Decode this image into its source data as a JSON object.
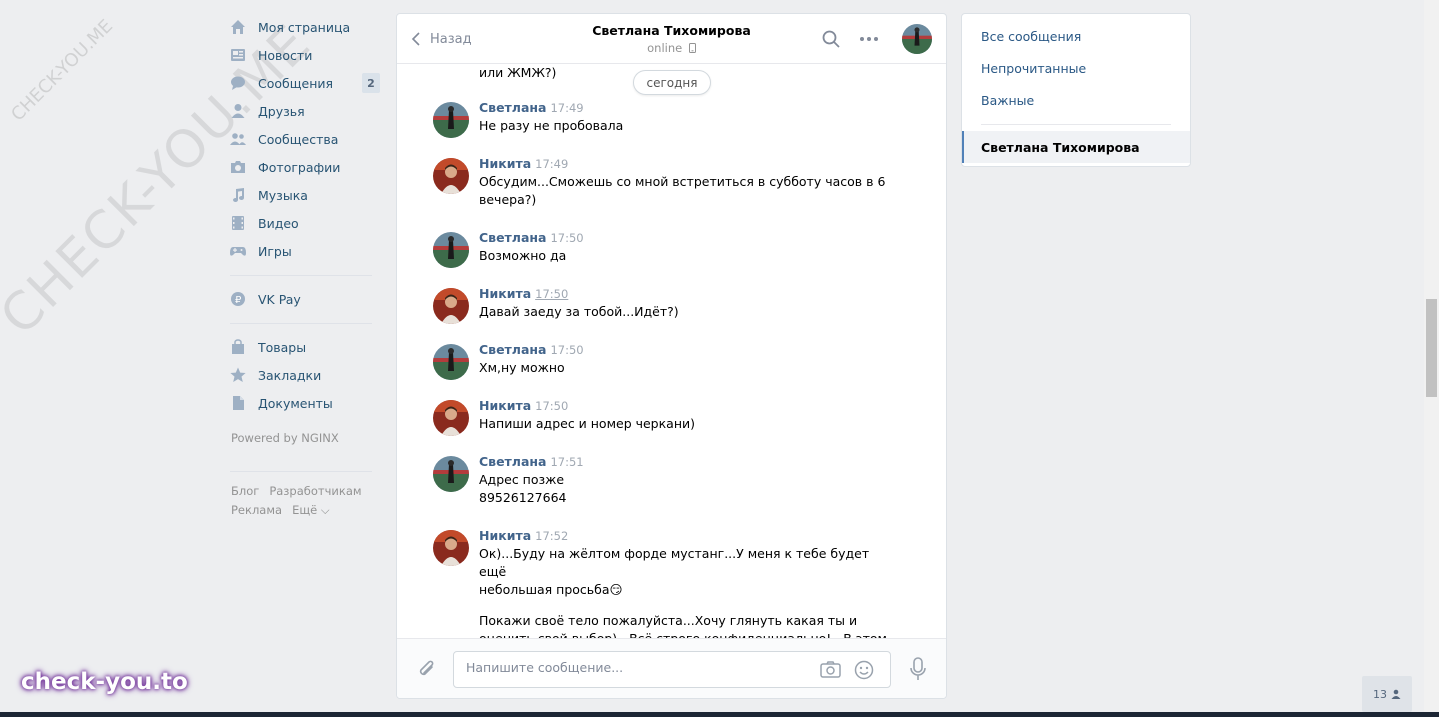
{
  "watermarks": {
    "diagonal_big": "CHECK-YOU.ME",
    "diagonal_small": "CHECK-YOU.ME",
    "brand": "check-you.to"
  },
  "leftnav": {
    "items": [
      {
        "label": "Моя страница",
        "icon": "home-icon"
      },
      {
        "label": "Новости",
        "icon": "news-icon"
      },
      {
        "label": "Сообщения",
        "icon": "messages-icon",
        "badge": "2"
      },
      {
        "label": "Друзья",
        "icon": "friends-icon"
      },
      {
        "label": "Сообщества",
        "icon": "communities-icon"
      },
      {
        "label": "Фотографии",
        "icon": "camera-icon"
      },
      {
        "label": "Музыка",
        "icon": "music-icon"
      },
      {
        "label": "Видео",
        "icon": "video-icon"
      },
      {
        "label": "Игры",
        "icon": "gamepad-icon"
      }
    ],
    "pay": {
      "label": "VK Pay",
      "icon": "vkpay-icon"
    },
    "extra": [
      {
        "label": "Товары",
        "icon": "bag-icon"
      },
      {
        "label": "Закладки",
        "icon": "star-icon"
      },
      {
        "label": "Документы",
        "icon": "document-icon"
      }
    ],
    "powered": "Powered by NGINX",
    "footer": {
      "blog": "Блог",
      "dev": "Разработчикам",
      "ads": "Реклама",
      "more": "Ещё ⌵"
    }
  },
  "chat": {
    "back_label": "Назад",
    "peer_name": "Светлана Тихомирова",
    "peer_status": "online",
    "prev_tail": "или ЖМЖ?)",
    "date_pill": "сегодня",
    "messages": [
      {
        "author": "Светлана",
        "time": "17:49",
        "who": "s",
        "texts": [
          "Не разу не пробовала"
        ]
      },
      {
        "author": "Никита",
        "time": "17:49",
        "who": "n",
        "texts": [
          "Обсудим...Сможешь со мной встретиться в субботу часов в 6\nвечера?)"
        ]
      },
      {
        "author": "Светлана",
        "time": "17:50",
        "who": "s",
        "texts": [
          "Возможно да"
        ]
      },
      {
        "author": "Никита",
        "time": "17:50",
        "who": "n",
        "underline": true,
        "texts": [
          "Давай заеду за тобой...Идёт?)"
        ]
      },
      {
        "author": "Светлана",
        "time": "17:50",
        "who": "s",
        "texts": [
          "Хм,ну можно"
        ]
      },
      {
        "author": "Никита",
        "time": "17:50",
        "who": "n",
        "texts": [
          "Напиши адрес и номер черкани)"
        ]
      },
      {
        "author": "Светлана",
        "time": "17:51",
        "who": "s",
        "texts": [
          "Адрес позже\n89526127664"
        ]
      },
      {
        "author": "Никита",
        "time": "17:52",
        "who": "n",
        "texts": [
          "Ок)...Буду на жёлтом форде мустанг...У меня к тебе будет ещё\nнебольшая просьба😏",
          "Покажи своё тело пожалуйста...Хочу глянуть какая ты и\nоценить свой выбор)...Всё строго конфиденциально!...В этом"
        ]
      }
    ],
    "composer_placeholder": "Напишите сообщение..."
  },
  "rightnav": {
    "all": "Все сообщения",
    "unread": "Непрочитанные",
    "important": "Важные",
    "active": "Светлана Тихомирова"
  },
  "counter": "13",
  "colors": {
    "link": "#2a5885",
    "author": "#42648b",
    "bg": "#edeef0",
    "accent": "#5181b8"
  }
}
